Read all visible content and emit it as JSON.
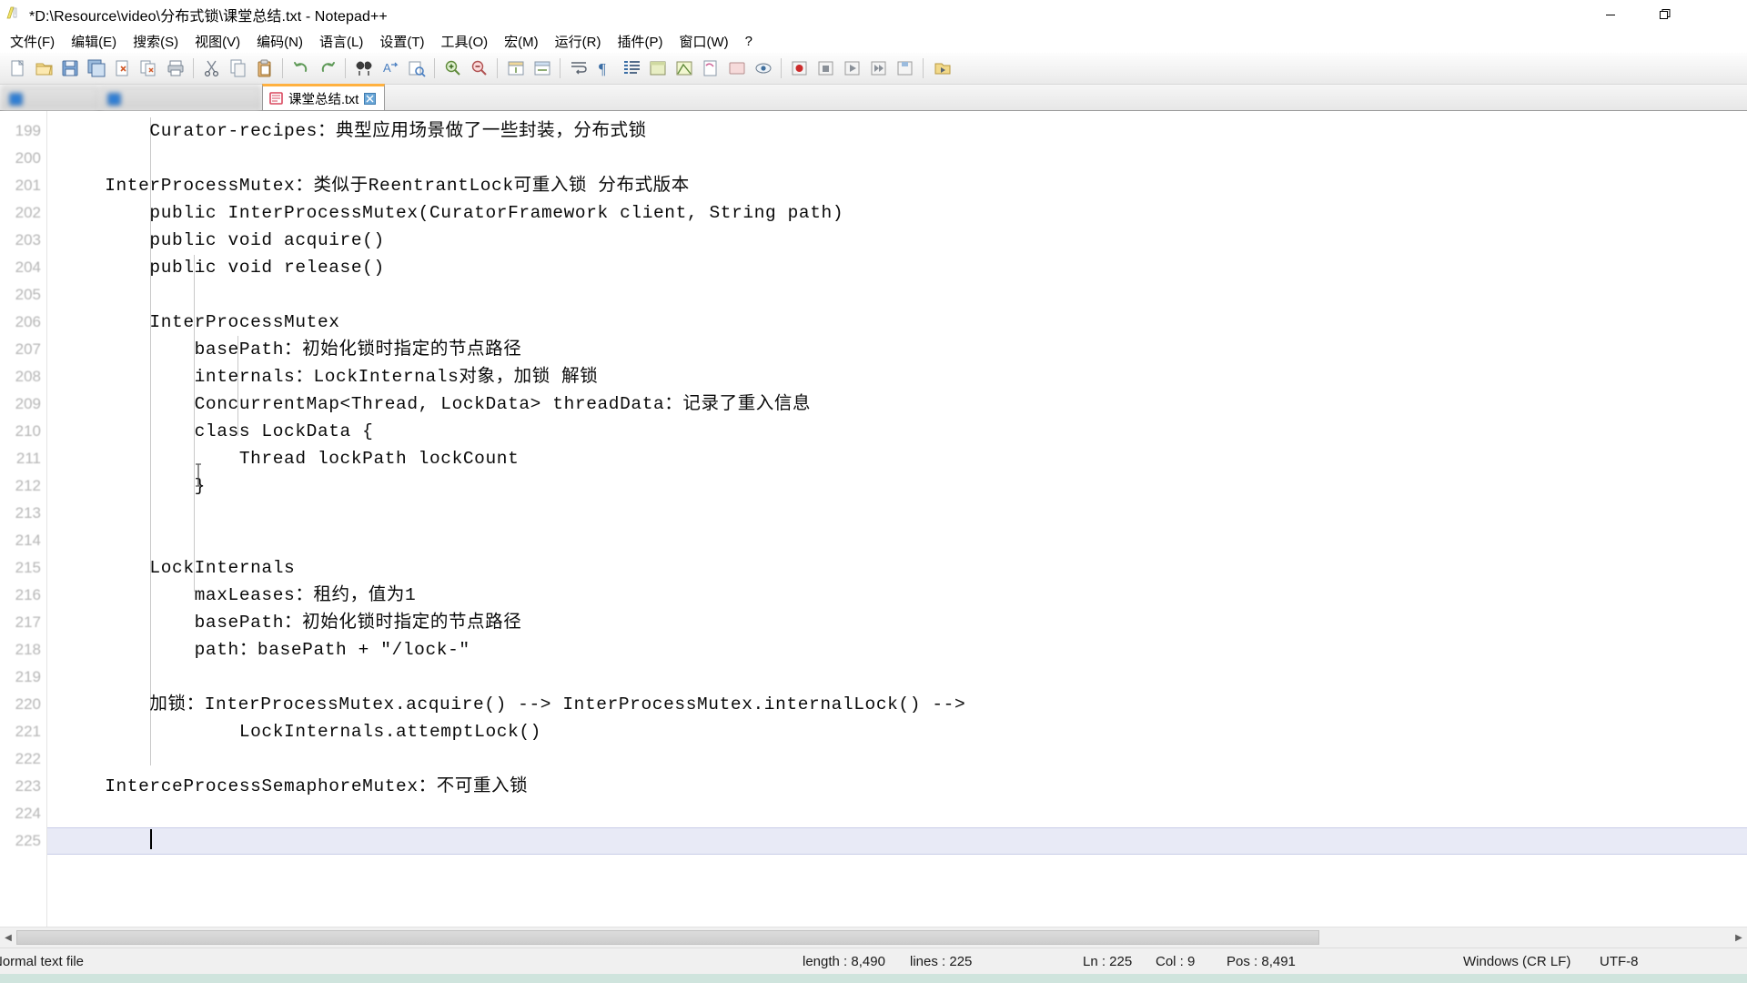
{
  "window": {
    "title": "*D:\\Resource\\video\\分布式锁\\课堂总结.txt - Notepad++",
    "minimize_label": "─",
    "restore_label": "❐",
    "close_label": "✕",
    "app_icon": "notepad-plus-plus-logo"
  },
  "menubar": {
    "items": [
      {
        "label": "文件(F)",
        "name": "menu-file"
      },
      {
        "label": "编辑(E)",
        "name": "menu-edit"
      },
      {
        "label": "搜索(S)",
        "name": "menu-search"
      },
      {
        "label": "视图(V)",
        "name": "menu-view"
      },
      {
        "label": "编码(N)",
        "name": "menu-encoding"
      },
      {
        "label": "语言(L)",
        "name": "menu-language"
      },
      {
        "label": "设置(T)",
        "name": "menu-settings"
      },
      {
        "label": "工具(O)",
        "name": "menu-tools"
      },
      {
        "label": "宏(M)",
        "name": "menu-macro"
      },
      {
        "label": "运行(R)",
        "name": "menu-run"
      },
      {
        "label": "插件(P)",
        "name": "menu-plugins"
      },
      {
        "label": "窗口(W)",
        "name": "menu-window"
      },
      {
        "label": "?",
        "name": "menu-help"
      }
    ]
  },
  "toolbar": {
    "buttons": [
      {
        "icon": "new-file-icon",
        "tip": "新建"
      },
      {
        "icon": "open-folder-icon",
        "tip": "打开"
      },
      {
        "icon": "save-icon",
        "tip": "保存"
      },
      {
        "icon": "save-all-icon",
        "tip": "保存所有"
      },
      {
        "icon": "close-file-icon",
        "tip": "关闭"
      },
      {
        "icon": "close-all-icon",
        "tip": "关闭所有"
      },
      {
        "icon": "print-icon",
        "tip": "打印"
      },
      {
        "sep": true
      },
      {
        "icon": "cut-icon",
        "tip": "剪切"
      },
      {
        "icon": "copy-icon",
        "tip": "复制"
      },
      {
        "icon": "paste-icon",
        "tip": "粘贴"
      },
      {
        "sep": true
      },
      {
        "icon": "undo-icon",
        "tip": "撤销"
      },
      {
        "icon": "redo-icon",
        "tip": "恢复"
      },
      {
        "sep": true
      },
      {
        "icon": "find-icon",
        "tip": "查找"
      },
      {
        "icon": "replace-icon",
        "tip": "替换"
      },
      {
        "icon": "find-in-files-icon",
        "tip": "在文件中查找"
      },
      {
        "sep": true
      },
      {
        "icon": "zoom-in-icon",
        "tip": "放大"
      },
      {
        "icon": "zoom-out-icon",
        "tip": "缩小"
      },
      {
        "sep": true
      },
      {
        "icon": "sync-vertical-icon",
        "tip": "垂直同步滚动"
      },
      {
        "icon": "sync-horizontal-icon",
        "tip": "水平同步滚动"
      },
      {
        "sep": true
      },
      {
        "icon": "word-wrap-icon",
        "tip": "自动换行"
      },
      {
        "icon": "show-all-chars-icon",
        "tip": "显示所有字符"
      },
      {
        "icon": "indent-guide-icon",
        "tip": "显示缩进参考线"
      },
      {
        "icon": "user-language-icon",
        "tip": "用户自定义语言"
      },
      {
        "icon": "function-list-icon",
        "tip": "函数列表"
      },
      {
        "icon": "doc-map-icon",
        "tip": "文档地图"
      },
      {
        "icon": "doc-switcher-icon",
        "tip": "文档列表"
      },
      {
        "icon": "monitoring-icon",
        "tip": "监视文件"
      },
      {
        "sep": true
      },
      {
        "icon": "record-macro-icon",
        "tip": "开始录制宏"
      },
      {
        "icon": "stop-macro-icon",
        "tip": "停止录制宏"
      },
      {
        "icon": "play-macro-icon",
        "tip": "播放宏"
      },
      {
        "icon": "run-macro-multiple-icon",
        "tip": "多次运行宏"
      },
      {
        "icon": "save-macro-icon",
        "tip": "保存录制的宏"
      },
      {
        "sep": true
      },
      {
        "icon": "run-icon",
        "tip": "运行"
      }
    ]
  },
  "tabs": [
    {
      "label": "",
      "name": "tab-obscured-1",
      "active": false,
      "blurred": true
    },
    {
      "label": "",
      "name": "tab-obscured-2",
      "active": false,
      "blurred": true
    },
    {
      "label": "课堂总结.txt",
      "name": "tab-kctj",
      "active": true,
      "blurred": false
    }
  ],
  "editor": {
    "first_line_number": 199,
    "current_line": 225,
    "lines": [
      {
        "n": 199,
        "text": "        Curator-recipes：典型应用场景做了一些封装，分布式锁"
      },
      {
        "n": 200,
        "text": ""
      },
      {
        "n": 201,
        "text": "    InterProcessMutex：类似于ReentrantLock可重入锁 分布式版本"
      },
      {
        "n": 202,
        "text": "        public InterProcessMutex(CuratorFramework client, String path)"
      },
      {
        "n": 203,
        "text": "        public void acquire()"
      },
      {
        "n": 204,
        "text": "        public void release()"
      },
      {
        "n": 205,
        "text": ""
      },
      {
        "n": 206,
        "text": "        InterProcessMutex"
      },
      {
        "n": 207,
        "text": "            basePath：初始化锁时指定的节点路径"
      },
      {
        "n": 208,
        "text": "            internals：LockInternals对象，加锁 解锁"
      },
      {
        "n": 209,
        "text": "            ConcurrentMap<Thread, LockData> threadData：记录了重入信息"
      },
      {
        "n": 210,
        "text": "            class LockData {"
      },
      {
        "n": 211,
        "text": "                Thread lockPath lockCount"
      },
      {
        "n": 212,
        "text": "            }"
      },
      {
        "n": 213,
        "text": ""
      },
      {
        "n": 214,
        "text": ""
      },
      {
        "n": 215,
        "text": "        LockInternals"
      },
      {
        "n": 216,
        "text": "            maxLeases：租约，值为1"
      },
      {
        "n": 217,
        "text": "            basePath：初始化锁时指定的节点路径"
      },
      {
        "n": 218,
        "text": "            path：basePath + \"/lock-\""
      },
      {
        "n": 219,
        "text": ""
      },
      {
        "n": 220,
        "text": "        加锁：InterProcessMutex.acquire() --> InterProcessMutex.internalLock() -->"
      },
      {
        "n": 221,
        "text": "                LockInternals.attemptLock()"
      },
      {
        "n": 222,
        "text": ""
      },
      {
        "n": 223,
        "text": "    InterceProcessSemaphoreMutex：不可重入锁"
      },
      {
        "n": 224,
        "text": ""
      },
      {
        "n": 225,
        "text": ""
      }
    ]
  },
  "scrollbar": {
    "left_arrow": "◀",
    "right_arrow": "▶",
    "thumb_percent": 76
  },
  "statusbar": {
    "doc_type": "Normal text file",
    "length": "length : 8,490",
    "lines": "lines : 225",
    "ln": "Ln : 225",
    "col": "Col : 9",
    "pos": "Pos : 8,491",
    "eol": "Windows (CR LF)",
    "encoding": "UTF-8"
  }
}
